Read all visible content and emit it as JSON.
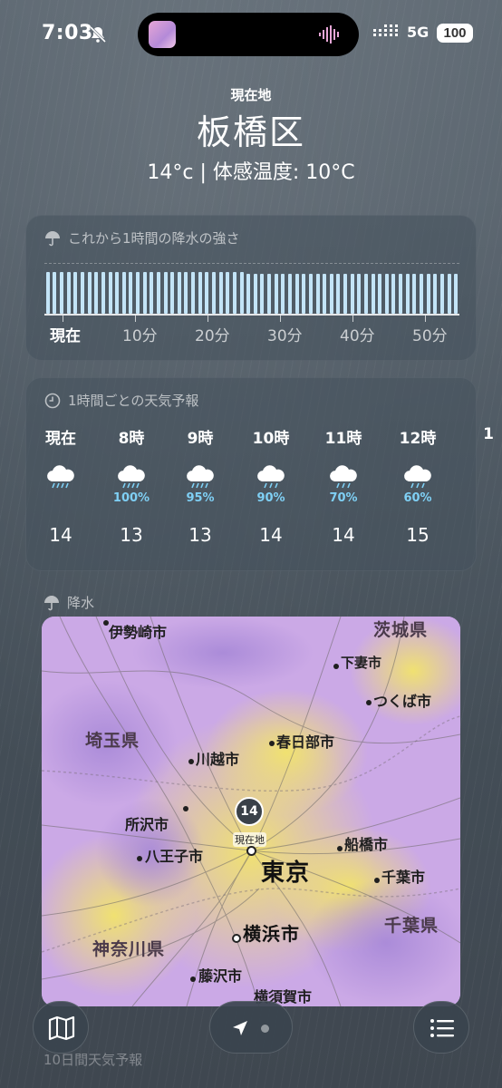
{
  "status_bar": {
    "time": "7:03",
    "network": "5G",
    "battery": "100",
    "icons": [
      "bell-slash-icon",
      "audio-wave-icon",
      "signal-icon"
    ]
  },
  "header": {
    "location_label": "現在地",
    "city": "板橋区",
    "temps": "14°c | 体感温度: 10°C"
  },
  "precip_card": {
    "title": "これから1時間の降水の強さ",
    "icon": "umbrella-icon",
    "axis_labels": [
      "現在",
      "10分",
      "20分",
      "30分",
      "40分",
      "50分"
    ],
    "intensity": [
      1,
      1,
      1,
      1,
      1,
      1,
      1,
      1,
      1,
      1,
      1,
      1,
      1,
      1,
      1,
      1,
      1,
      1,
      1,
      1,
      1,
      1,
      1,
      1,
      1,
      1,
      1,
      1,
      1,
      0.96,
      0.96,
      0.96,
      0.96,
      0.96,
      0.96,
      0.96,
      0.96,
      0.96,
      0.96,
      0.96,
      0.96,
      0.96,
      0.96,
      0.96,
      0.96,
      0.96,
      0.96,
      0.96,
      0.96,
      0.96,
      0.96,
      0.96,
      0.96,
      0.96,
      0.96,
      0.96,
      0.96,
      0.96,
      0.96,
      0.96
    ]
  },
  "hourly_card": {
    "title": "1時間ごとの天気予報",
    "icon": "clock-icon",
    "hours": [
      {
        "label": "現在",
        "pct": "",
        "temp": "14"
      },
      {
        "label": "8時",
        "pct": "100%",
        "temp": "13"
      },
      {
        "label": "9時",
        "pct": "95%",
        "temp": "13"
      },
      {
        "label": "10時",
        "pct": "90%",
        "temp": "14"
      },
      {
        "label": "11時",
        "pct": "70%",
        "temp": "14"
      },
      {
        "label": "12時",
        "pct": "60%",
        "temp": "15"
      },
      {
        "label": "1",
        "pct": "",
        "temp": ""
      }
    ]
  },
  "map_card": {
    "title": "降水",
    "icon": "umbrella-icon",
    "places": {
      "isesaki": "伊勢崎市",
      "ibaraki": "茨城県",
      "shimotsuma": "下妻市",
      "tsukuba": "つくば市",
      "saitama": "埼玉県",
      "kasukabe": "春日部市",
      "kawagoe": "川越市",
      "tokorozawa": "所沢市",
      "hachioji": "八王子市",
      "tokyo": "東京",
      "funabashi": "船橋市",
      "chiba_city": "千葉市",
      "chiba_pref": "千葉県",
      "kanagawa": "神奈川県",
      "yokohama": "横浜市",
      "fujisawa": "藤沢市",
      "yokosuka": "横須賀市"
    },
    "pin_temp": "14",
    "pin_label": "現在地"
  },
  "next_card": {
    "title": "10日間天気予報"
  },
  "bottom_bar": {
    "map_button": "map-icon",
    "location_button": "location-arrow-icon",
    "list_button": "list-icon"
  }
}
